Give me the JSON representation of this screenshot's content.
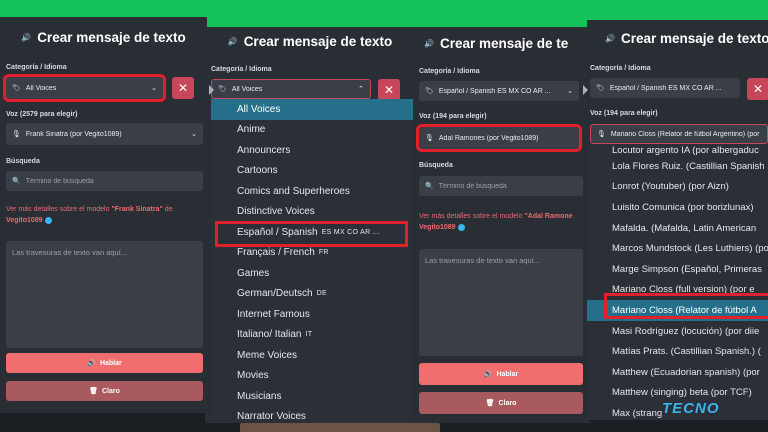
{
  "panel1": {
    "title": "Crear mensaje de texto",
    "category_label": "Categoría / Idioma",
    "category_value": "All Voices",
    "voice_label": "Voz (2579 para elegir)",
    "voice_value": "Frank Sinatra (por Vegito1089)",
    "search_label": "Búsqueda",
    "search_placeholder": "Término de búsqueda",
    "info_text": "Ver más detalles sobre el modelo",
    "info_model": "\"Frank Sinatra\"",
    "info_de": "de",
    "info_author": "Vegito1089",
    "text_placeholder": "Las travesuras de texto van aquí...",
    "speak_label": "Hablar",
    "clear_label": "Claro"
  },
  "panel2": {
    "title": "Crear mensaje de texto",
    "category_label": "Categoría / Idioma",
    "category_value": "All Voices",
    "options": [
      {
        "label": "All Voices",
        "tag": ""
      },
      {
        "label": "Anime",
        "tag": ""
      },
      {
        "label": "Announcers",
        "tag": ""
      },
      {
        "label": "Cartoons",
        "tag": ""
      },
      {
        "label": "Comics and Superheroes",
        "tag": ""
      },
      {
        "label": "Distinctive Voices",
        "tag": ""
      },
      {
        "label": "Español / Spanish",
        "tag": "ES MX CO AR ..."
      },
      {
        "label": "Français / French",
        "tag": "FR"
      },
      {
        "label": "Games",
        "tag": ""
      },
      {
        "label": "German/Deutsch",
        "tag": "DE"
      },
      {
        "label": "Internet Famous",
        "tag": ""
      },
      {
        "label": "Italiano/ Italian",
        "tag": "IT"
      },
      {
        "label": "Meme Voices",
        "tag": ""
      },
      {
        "label": "Movies",
        "tag": ""
      },
      {
        "label": "Musicians",
        "tag": ""
      },
      {
        "label": "Narrator Voices",
        "tag": ""
      }
    ]
  },
  "panel3": {
    "title": "Crear mensaje de te",
    "category_label": "Categoría / Idioma",
    "category_value": "Español / Spanish ES MX CO AR ...",
    "voice_label": "Voz (194 para elegir)",
    "voice_value": "Adal Ramones (por Vegito1089)",
    "search_label": "Búsqueda",
    "search_placeholder": "Término de búsqueda",
    "info_text": "Ver más detalles sobre el modelo",
    "info_model": "\"Adal Ramone",
    "info_author": "Vegito1089",
    "text_placeholder": "Las travesuras de texto van aquí...",
    "speak_label": "Hablar",
    "clear_label": "Claro"
  },
  "panel4": {
    "title": "Crear mensaje de texto",
    "category_label": "Categoría / Idioma",
    "category_value": "Español / Spanish ES MX CO AR ...",
    "voice_label": "Voz (194 para elegir)",
    "voice_value": "Mariano Closs (Relator de fútbol Argentino) (por",
    "voices": [
      "Locutor argento IA (por albergaduc",
      "Lola Flores Ruiz. (Castillian Spanish",
      "Lonrot (Youtuber) (por Aizn)",
      "Luisito Comunica (por borizlunax)",
      "Mafalda. (Mafalda, Latin American",
      "Marcos Mundstock (Les Luthiers) (por",
      "Marge Simpson (Español, Primeras",
      "Mariano Closs (full version) (por e",
      "Mariano Closs (Relator de fútbol A",
      "Masi Rodríguez (locución) (por diie",
      "Matías Prats. (Castillian Spanish.) (",
      "Matthew (Ecuadorian spanish) (por",
      "Matthew (singing) beta (por TCF)",
      "Max (strang"
    ]
  },
  "logo_text": "TECNO",
  "colors": {
    "green": "#16c25a",
    "panel": "#292d34",
    "field": "#3a3f47",
    "accent": "#256f8a",
    "red": "#e0212b",
    "speak": "#f06e6e"
  }
}
